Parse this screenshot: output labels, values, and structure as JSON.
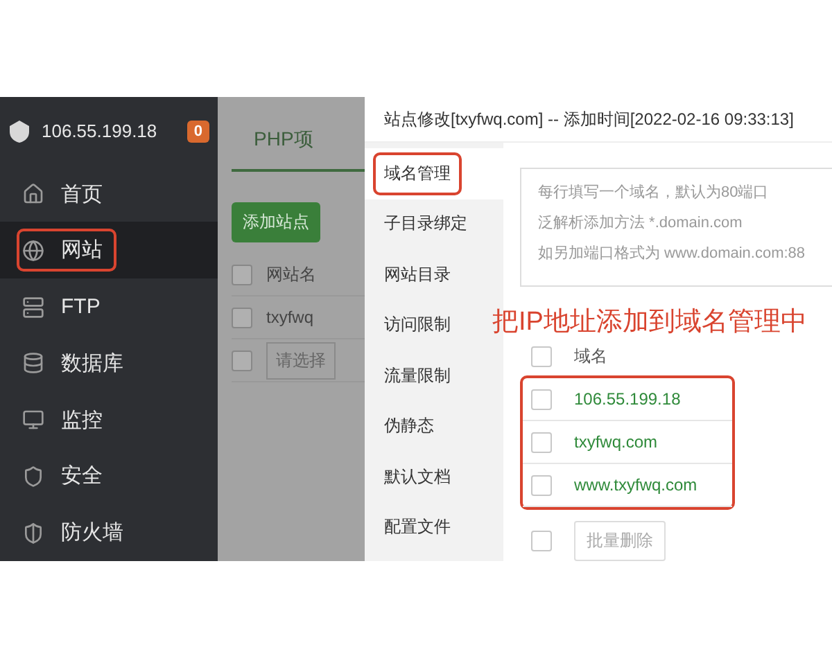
{
  "sidebar": {
    "server": "106.55.199.18",
    "badge": "0",
    "items": [
      {
        "label": "首页",
        "kind": "home",
        "selected": false,
        "annotated": false
      },
      {
        "label": "网站",
        "kind": "globe",
        "selected": true,
        "annotated": true
      },
      {
        "label": "FTP",
        "kind": "server",
        "selected": false,
        "annotated": false
      },
      {
        "label": "数据库",
        "kind": "database",
        "selected": false,
        "annotated": false
      },
      {
        "label": "监控",
        "kind": "monitor",
        "selected": false,
        "annotated": false
      },
      {
        "label": "安全",
        "kind": "shield",
        "selected": false,
        "annotated": false
      },
      {
        "label": "防火墙",
        "kind": "firewall",
        "selected": false,
        "annotated": false
      }
    ]
  },
  "background_page": {
    "tab": "PHP项",
    "add_button": "添加站点",
    "column": "网站名",
    "header_checked": false,
    "row": "txyfwq",
    "row_checked": false,
    "select_placeholder": "请选择",
    "select_checked": false
  },
  "dialog": {
    "title": "站点修改[txyfwq.com] -- 添加时间[2022-02-16 09:33:13]",
    "nav": [
      {
        "label": "域名管理",
        "selected": true,
        "annotated": true
      },
      {
        "label": "子目录绑定",
        "selected": false,
        "annotated": false
      },
      {
        "label": "网站目录",
        "selected": false,
        "annotated": false
      },
      {
        "label": "访问限制",
        "selected": false,
        "annotated": false
      },
      {
        "label": "流量限制",
        "selected": false,
        "annotated": false
      },
      {
        "label": "伪静态",
        "selected": false,
        "annotated": false
      },
      {
        "label": "默认文档",
        "selected": false,
        "annotated": false
      },
      {
        "label": "配置文件",
        "selected": false,
        "annotated": false
      }
    ],
    "domain_field": {
      "placeholder_lines": [
        "每行填写一个域名，默认为80端口",
        "泛解析添加方法 *.domain.com",
        "如另加端口格式为 www.domain.com:88"
      ]
    },
    "header_checked": false,
    "footer_checked": false,
    "annotation": "把IP地址添加到域名管理中",
    "column": "域名",
    "rows_annotated": true,
    "rows": [
      {
        "domain": "106.55.199.18",
        "checked": false
      },
      {
        "domain": "txyfwq.com",
        "checked": false
      },
      {
        "domain": "www.txyfwq.com",
        "checked": false
      }
    ],
    "batch_delete": "批量删除"
  }
}
